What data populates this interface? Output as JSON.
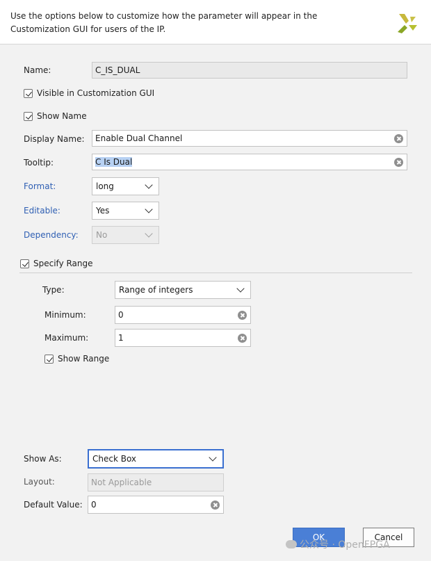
{
  "header": {
    "description": "Use the options below to customize how the parameter will appear in the Customization GUI for users of the IP.",
    "logo_icon": "xilinx-logo-icon"
  },
  "form": {
    "name_label": "Name:",
    "name_value": "C_IS_DUAL",
    "visible_label": "Visible in Customization GUI",
    "visible_checked": true,
    "show_name_label": "Show Name",
    "show_name_checked": true,
    "display_name_label": "Display Name:",
    "display_name_value": "Enable Dual Channel",
    "tooltip_label": "Tooltip:",
    "tooltip_value": "C Is Dual",
    "format_label": "Format:",
    "format_value": "long",
    "editable_label": "Editable:",
    "editable_value": "Yes",
    "dependency_label": "Dependency:",
    "dependency_value": "No",
    "specify_range_label": "Specify Range",
    "specify_range_checked": true
  },
  "range": {
    "type_label": "Type:",
    "type_value": "Range of integers",
    "minimum_label": "Minimum:",
    "minimum_value": "0",
    "maximum_label": "Maximum:",
    "maximum_value": "1",
    "show_range_label": "Show Range",
    "show_range_checked": true
  },
  "display": {
    "show_as_label": "Show As:",
    "show_as_value": "Check Box",
    "layout_label": "Layout:",
    "layout_value": "Not Applicable",
    "default_value_label": "Default Value:",
    "default_value": "0"
  },
  "buttons": {
    "ok_label": "OK",
    "cancel_label": "Cancel"
  },
  "watermark": {
    "text": "公众号 · OpenFPGA"
  },
  "colors": {
    "link_label": "#2f5fb3",
    "ok_button": "#4a7fd6",
    "focus_border": "#3a6fd0",
    "selection_highlight": "#b7d1f3"
  }
}
